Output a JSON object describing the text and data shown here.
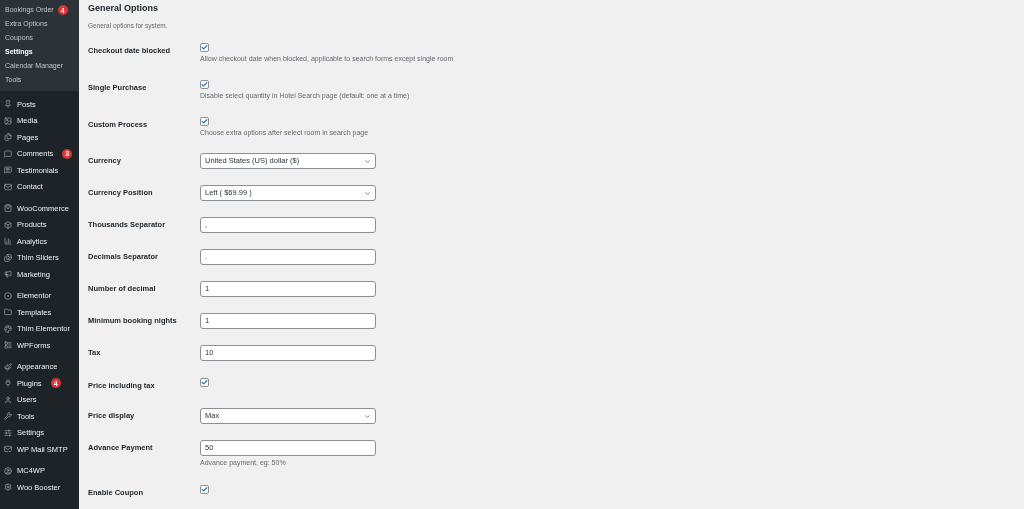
{
  "sidebar": {
    "submenu": [
      {
        "label": "Bookings Order",
        "badge": "4",
        "selected": false
      },
      {
        "label": "Extra Options",
        "selected": false
      },
      {
        "label": "Coupons",
        "selected": false
      },
      {
        "label": "Settings",
        "selected": true
      },
      {
        "label": "Calendar Manager",
        "selected": false
      },
      {
        "label": "Tools",
        "selected": false
      }
    ],
    "groups": [
      [
        {
          "label": "Posts"
        },
        {
          "label": "Media"
        },
        {
          "label": "Pages"
        },
        {
          "label": "Comments",
          "badge": "3"
        },
        {
          "label": "Testimonials"
        },
        {
          "label": "Contact"
        }
      ],
      [
        {
          "label": "WooCommerce"
        },
        {
          "label": "Products"
        },
        {
          "label": "Analytics"
        },
        {
          "label": "Thim Sliders"
        },
        {
          "label": "Marketing"
        }
      ],
      [
        {
          "label": "Elementor"
        },
        {
          "label": "Templates"
        },
        {
          "label": "Thim Elementor"
        },
        {
          "label": "WPForms"
        }
      ],
      [
        {
          "label": "Appearance"
        },
        {
          "label": "Plugins",
          "badge": "4"
        },
        {
          "label": "Users"
        },
        {
          "label": "Tools"
        },
        {
          "label": "Settings"
        },
        {
          "label": "WP Mail SMTP"
        }
      ],
      [
        {
          "label": "MC4WP"
        },
        {
          "label": "Woo Booster"
        }
      ]
    ]
  },
  "section": {
    "title": "General Options",
    "description": "General options for system."
  },
  "fields": [
    {
      "kind": "checkbox",
      "label": "Checkout date blocked",
      "checked": true,
      "description": "Allow checkout date when blocked, applicable to search forms except single room"
    },
    {
      "kind": "checkbox",
      "label": "Single Purchase",
      "checked": true,
      "description": "Disable select quantity in Hotel Search page (default: one at a time)"
    },
    {
      "kind": "checkbox",
      "label": "Custom Process",
      "checked": true,
      "description": "Choose extra options after select room in search page"
    },
    {
      "kind": "select",
      "label": "Currency",
      "value": "United States (US) dollar ($)"
    },
    {
      "kind": "select",
      "label": "Currency Position",
      "value": "Left ( $69.99 )"
    },
    {
      "kind": "input",
      "label": "Thousands Separator",
      "value": ","
    },
    {
      "kind": "input",
      "label": "Decimals Separator",
      "value": "."
    },
    {
      "kind": "input",
      "label": "Number of decimal",
      "value": "1"
    },
    {
      "kind": "input",
      "label": "Minimum booking nights",
      "value": "1"
    },
    {
      "kind": "input",
      "label": "Tax",
      "value": "10"
    },
    {
      "kind": "checkbox",
      "label": "Price including tax",
      "checked": true
    },
    {
      "kind": "select",
      "label": "Price display",
      "value": "Max"
    },
    {
      "kind": "input",
      "label": "Advance Payment",
      "value": "50",
      "description": "Advance payment, eg: 50%"
    },
    {
      "kind": "checkbox",
      "label": "Enable Coupon",
      "checked": true
    }
  ]
}
